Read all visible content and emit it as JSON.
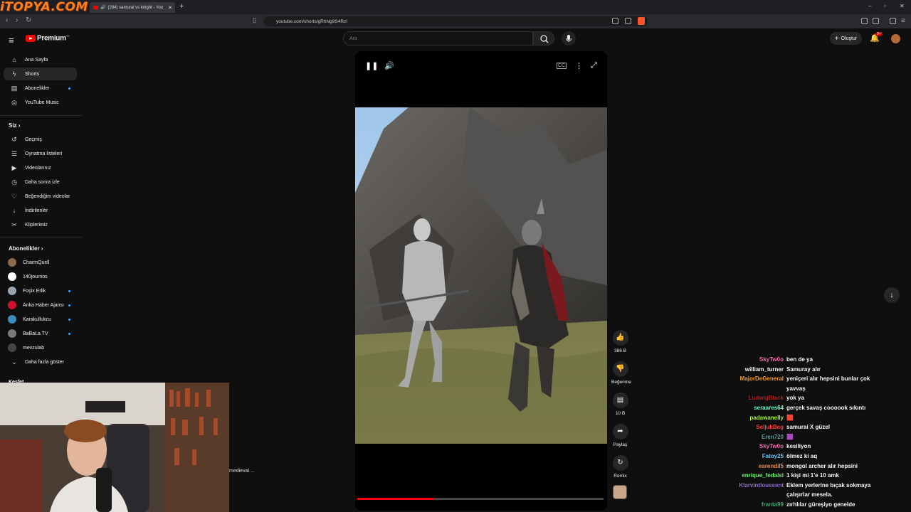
{
  "browser": {
    "tab_title": "(284) samurai vs knight - You",
    "url": "youtube.com/shorts/gRhNg9S4RzI",
    "overlay_logo": "iTOPYA.COM"
  },
  "header": {
    "brand": "Premium",
    "brand_sup": "TR",
    "search_placeholder": "Ara",
    "create_label": "Oluştur",
    "notif_badge": "9+"
  },
  "sidebar": {
    "main": [
      {
        "label": "Ana Sayfa",
        "icon": "home-icon",
        "glyph": "⌂"
      },
      {
        "label": "Shorts",
        "icon": "shorts-icon",
        "glyph": "ϟ"
      },
      {
        "label": "Abonelikler",
        "icon": "subscriptions-icon",
        "glyph": "▤"
      },
      {
        "label": "YouTube Music",
        "icon": "music-icon",
        "glyph": "◎"
      }
    ],
    "you_header": "Siz",
    "you": [
      {
        "label": "Geçmiş",
        "icon": "history-icon",
        "glyph": "↺"
      },
      {
        "label": "Oynatma listeleri",
        "icon": "playlist-icon",
        "glyph": "☰"
      },
      {
        "label": "Videolarınız",
        "icon": "your-videos-icon",
        "glyph": "▶"
      },
      {
        "label": "Daha sonra izle",
        "icon": "watch-later-icon",
        "glyph": "◷"
      },
      {
        "label": "Beğendiğim videolar",
        "icon": "liked-icon",
        "glyph": "♡"
      },
      {
        "label": "İndirilenler",
        "icon": "download-icon",
        "glyph": "↓"
      },
      {
        "label": "Kliplerimiz",
        "icon": "clips-icon",
        "glyph": "✂"
      }
    ],
    "subs_header": "Abonelikler",
    "subs": [
      {
        "label": "CharmQuell",
        "color": "#8a6a4a"
      },
      {
        "label": "140journos",
        "color": "#ffffff"
      },
      {
        "label": "Foşix Erlik",
        "color": "#9aa4b0"
      },
      {
        "label": "Anka Haber Ajansı",
        "color": "#d0112b"
      },
      {
        "label": "Karakullukcu",
        "color": "#3c8dbc"
      },
      {
        "label": "BaBaLa TV",
        "color": "#7a7a7a"
      },
      {
        "label": "mevzulab",
        "color": "#444444"
      }
    ],
    "show_more": "Daha fazla göster",
    "explore": "Keşfet"
  },
  "player": {
    "progress": 0.31,
    "caption": "medieval ..."
  },
  "actions": {
    "likes": "386 B",
    "dislike": "Beğenme",
    "comments": "10 B",
    "share": "Paylaş",
    "remix": "Remix"
  },
  "chat": [
    {
      "user": "SkyTw0o",
      "text": "ben de ya",
      "color": "#ff69b4"
    },
    {
      "user": "william_turner",
      "text": "Samuray alır",
      "color": "#ffffff"
    },
    {
      "user": "MajorDeGeneral",
      "text": "yeniçeri alır hepsini bunlar çok yavvaş",
      "color": "#ff9f1c"
    },
    {
      "user": "LudwigBlack",
      "text": "yok ya",
      "color": "#b22222"
    },
    {
      "user": "seraares64",
      "text": "gerçek savaş coooook sıkıntı",
      "color": "#7fffd4"
    },
    {
      "user": "padawanelly",
      "text": "🟥",
      "color": "#adff2f"
    },
    {
      "user": "SeljukBeg",
      "text": "samurai X güzel",
      "color": "#ff4040"
    },
    {
      "user": "Eren720",
      "text": "🟪",
      "color": "#5f9ea0"
    },
    {
      "user": "SkyTw0o",
      "text": "kesiliyon",
      "color": "#ff69b4"
    },
    {
      "user": "Fatoy25",
      "text": "ölmez ki aq",
      "color": "#66ccff"
    },
    {
      "user": "earendil5",
      "text": "mongol archer alır hepsini",
      "color": "#ff8c42"
    },
    {
      "user": "enrique_fedaisi",
      "text": "1 kişi mi 1'e 10 amk",
      "color": "#66ff66"
    },
    {
      "user": "Klarvintloussent",
      "text": "Eklem yerlerine bıçak sokmaya çalışırlar mesela.",
      "color": "#9370db"
    },
    {
      "user": "franta99",
      "text": "zırhlılar güreşiyo genelde",
      "color": "#3cb371"
    }
  ]
}
